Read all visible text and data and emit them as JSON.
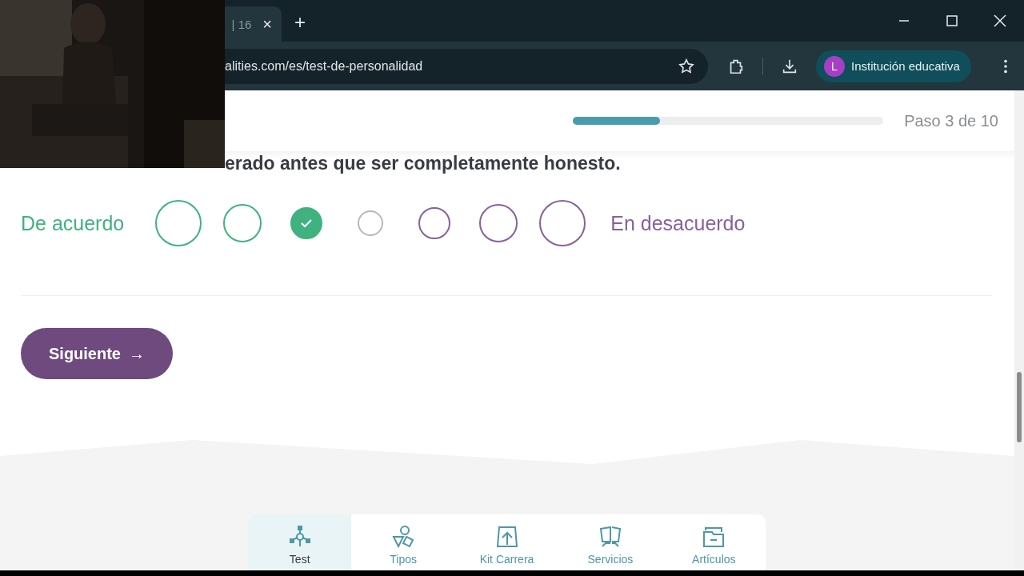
{
  "browser": {
    "tab_title": "| 16",
    "tab_close": "×",
    "new_tab": "+",
    "url": "alities.com/es/test-de-personalidad",
    "profile_initial": "L",
    "profile_name": "Institución educativa"
  },
  "header": {
    "progress": {
      "level": 0.28
    },
    "step": "Paso 3 de 10"
  },
  "question": {
    "text": "erado antes que ser completamente honesto.",
    "left_label": "De acuerdo",
    "right_label": "En desacuerdo",
    "options": [
      {
        "kind": "agree",
        "selected": false
      },
      {
        "kind": "agree",
        "selected": false
      },
      {
        "kind": "agree",
        "selected": true
      },
      {
        "kind": "neutral",
        "selected": false
      },
      {
        "kind": "disagree",
        "selected": false
      },
      {
        "kind": "disagree",
        "selected": false
      },
      {
        "kind": "disagree",
        "selected": false
      }
    ]
  },
  "next_button": {
    "label": "Siguiente",
    "arrow": "→"
  },
  "bottom_nav": [
    {
      "label": "Test",
      "selected": true
    },
    {
      "label": "Tipos",
      "selected": false
    },
    {
      "label": "Kit Carrera",
      "selected": false
    },
    {
      "label": "Servicios",
      "selected": false
    },
    {
      "label": "Artículos",
      "selected": false
    }
  ]
}
